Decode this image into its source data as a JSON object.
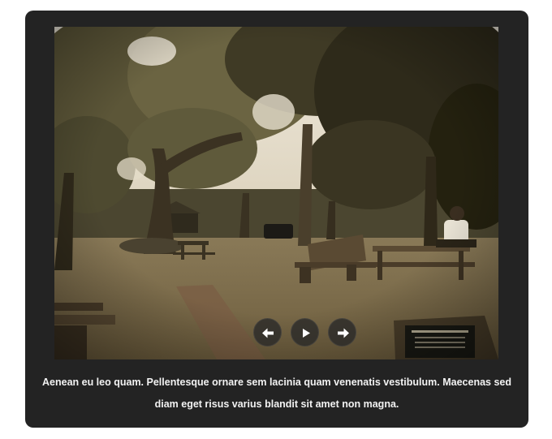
{
  "slideshow": {
    "caption": "Aenean eu leo quam. Pellentesque ornare sem lacinia quam venenatis vestibulum. Maecenas sed diam eget risus varius blandit sit amet non magna.",
    "image": {
      "subject": "park-with-oak-trees-and-picnic-tables",
      "tone_color": "#7a6a4a"
    },
    "controls": {
      "prev_icon": "arrow-left-icon",
      "play_icon": "play-icon",
      "next_icon": "arrow-right-icon",
      "button_color": "#2a2a2a",
      "icon_color": "#ffffff"
    },
    "frame_color": "#232323"
  }
}
